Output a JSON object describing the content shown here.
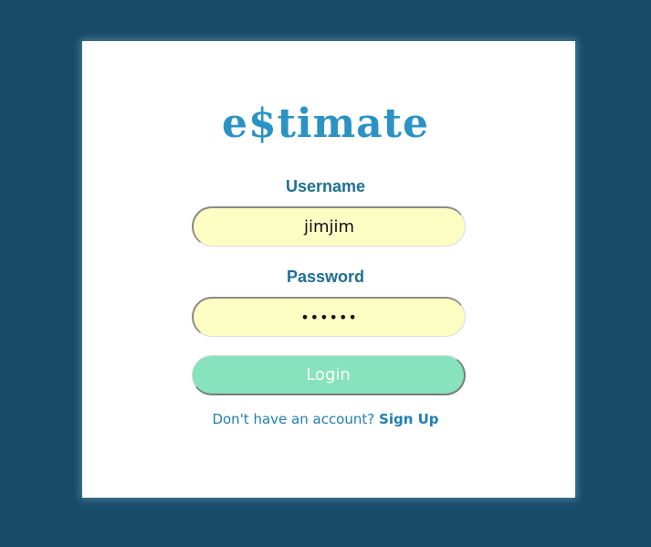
{
  "app": {
    "logo_text": "e$timate",
    "brand_color": "#2b93c4",
    "background_color": "#174c69"
  },
  "form": {
    "username_label": "Username",
    "username_value": "jimjim",
    "password_label": "Password",
    "password_value": "••••••",
    "input_fill_color": "#fbfdc3",
    "login_label": "Login",
    "login_button_color": "#86e3bd"
  },
  "footer": {
    "prompt_text": "Don't have an account?",
    "signup_label": "Sign Up"
  }
}
